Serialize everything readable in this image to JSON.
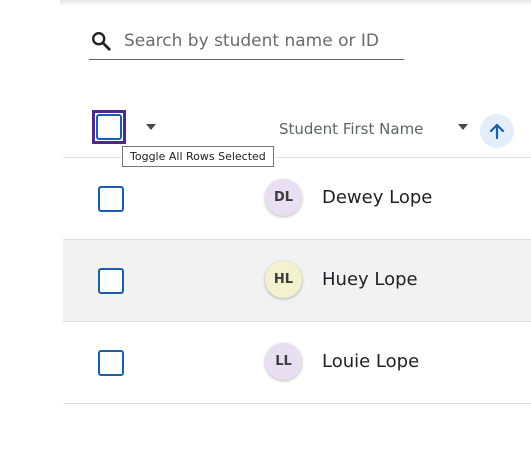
{
  "search": {
    "placeholder": "Search by student name or ID",
    "value": ""
  },
  "header": {
    "select_all_checked": false,
    "column_label": "Student First Name",
    "sort_direction": "ascending"
  },
  "tooltip": {
    "text": "Toggle All Rows Selected"
  },
  "rows": [
    {
      "initials": "DL",
      "name": "Dewey Lope",
      "avatar_color": "#e8e0f2",
      "selected": false
    },
    {
      "initials": "HL",
      "name": "Huey Lope",
      "avatar_color": "#f3f2cf",
      "selected": false
    },
    {
      "initials": "LL",
      "name": "Louie Lope",
      "avatar_color": "#e8e0f2",
      "selected": false
    }
  ],
  "colors": {
    "checkbox_border": "#1b5fa8",
    "focus_ring": "#4b2a8f",
    "sort_button_bg": "#e3eefa",
    "sort_arrow": "#1b5fa8",
    "alt_row_bg": "#f2f2f2"
  },
  "icons": {
    "search": "search-icon",
    "bulk_menu": "caret-down-icon",
    "column_menu": "caret-down-icon",
    "sort": "arrow-up-icon"
  }
}
